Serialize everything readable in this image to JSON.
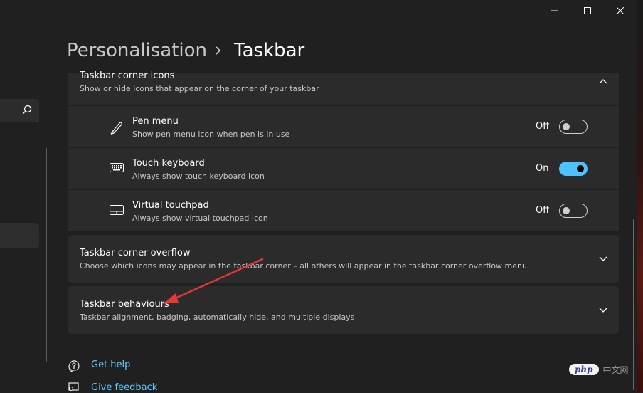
{
  "breadcrumb": {
    "parent": "Personalisation",
    "separator": "›",
    "current": "Taskbar"
  },
  "corner_icons": {
    "title": "Taskbar corner icons",
    "description": "Show or hide icons that appear on the corner of your taskbar",
    "items": [
      {
        "icon": "pen-icon",
        "title": "Pen menu",
        "description": "Show pen menu icon when pen is in use",
        "state": "Off"
      },
      {
        "icon": "keyboard-icon",
        "title": "Touch keyboard",
        "description": "Always show touch keyboard icon",
        "state": "On"
      },
      {
        "icon": "touchpad-icon",
        "title": "Virtual touchpad",
        "description": "Always show virtual touchpad icon",
        "state": "Off"
      }
    ]
  },
  "corner_overflow": {
    "title": "Taskbar corner overflow",
    "description": "Choose which icons may appear in the taskbar corner – all others will appear in the taskbar corner overflow menu"
  },
  "behaviours": {
    "title": "Taskbar behaviours",
    "description": "Taskbar alignment, badging, automatically hide, and multiple displays"
  },
  "help": {
    "get_help": "Get help",
    "give_feedback": "Give feedback"
  },
  "watermark": {
    "logo": "php",
    "site": "中文网"
  },
  "colors": {
    "background": "#202020",
    "card": "#2b2b2b",
    "accent": "#4cc2ff",
    "link": "#60cdff",
    "annotation_arrow": "#e53935"
  }
}
